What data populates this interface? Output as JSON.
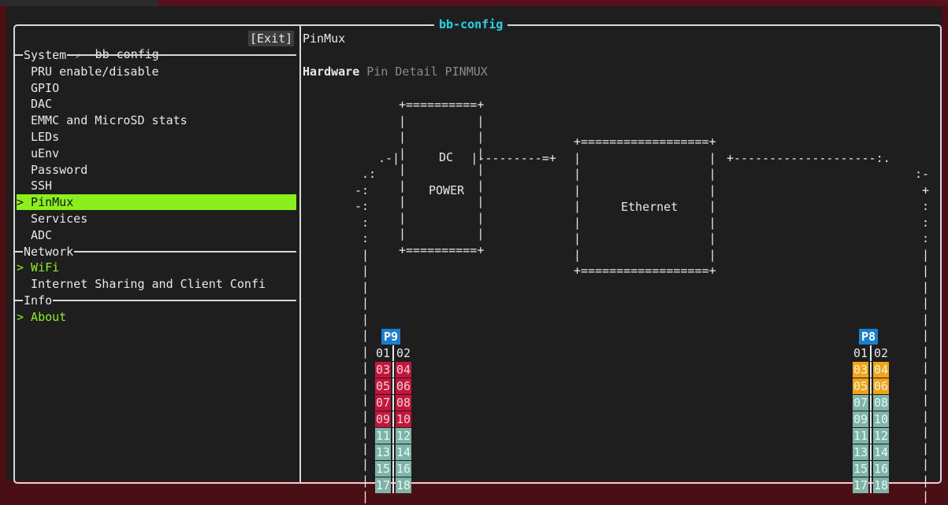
{
  "frame": {
    "title": "bb-config"
  },
  "sidebar": {
    "app_name": "bb-config",
    "app_icon_glyph": "↗",
    "exit_label": "[Exit]",
    "sections": [
      {
        "title": "System",
        "items": [
          "PRU enable/disable",
          "GPIO",
          "DAC",
          "EMMC and MicroSD stats",
          "LEDs",
          "uEnv",
          "Password",
          "SSH",
          "PinMux",
          "Services",
          "ADC"
        ]
      },
      {
        "title": "Network",
        "items": [
          "WiFi",
          "Internet Sharing and Client Confi"
        ]
      },
      {
        "title": "Info",
        "items": [
          "About"
        ]
      }
    ],
    "selected_item": "PinMux",
    "arrow": ">"
  },
  "content": {
    "title": "PinMux",
    "tabs": [
      {
        "label": "Hardware",
        "active": true
      },
      {
        "label": "Pin Detail",
        "active": false
      },
      {
        "label": "PINMUX",
        "active": false
      }
    ],
    "diagram": {
      "dc_label": "DC",
      "power_label": "POWER",
      "ethernet_label": "Ethernet"
    },
    "headers": {
      "p9": {
        "label": "P9",
        "rows": [
          {
            "left": "01",
            "right": "02",
            "style": "plain"
          },
          {
            "left": "03",
            "right": "04",
            "style": "red"
          },
          {
            "left": "05",
            "right": "06",
            "style": "red"
          },
          {
            "left": "07",
            "right": "08",
            "style": "red"
          },
          {
            "left": "09",
            "right": "10",
            "style": "red"
          },
          {
            "left": "11",
            "right": "12",
            "style": "teal"
          },
          {
            "left": "13",
            "right": "14",
            "style": "teal"
          },
          {
            "left": "15",
            "right": "16",
            "style": "teal"
          },
          {
            "left": "17",
            "right": "18",
            "style": "teal"
          }
        ]
      },
      "p8": {
        "label": "P8",
        "rows": [
          {
            "left": "01",
            "right": "02",
            "style": "plain"
          },
          {
            "left": "03",
            "right": "04",
            "style": "orange"
          },
          {
            "left": "05",
            "right": "06",
            "style": "orange"
          },
          {
            "left": "07",
            "right": "08",
            "style": "teal"
          },
          {
            "left": "09",
            "right": "10",
            "style": "teal"
          },
          {
            "left": "11",
            "right": "12",
            "style": "teal"
          },
          {
            "left": "13",
            "right": "14",
            "style": "teal"
          },
          {
            "left": "15",
            "right": "16",
            "style": "teal"
          },
          {
            "left": "17",
            "right": "18",
            "style": "teal"
          }
        ]
      }
    }
  },
  "colors": {
    "title_cyan": "#26d4e6",
    "selection_green": "#8bf01a",
    "header_blue": "#1b7fd1",
    "pin_red": "#c4163a",
    "pin_teal": "#7fb5a8",
    "pin_orange": "#f0a41a"
  }
}
